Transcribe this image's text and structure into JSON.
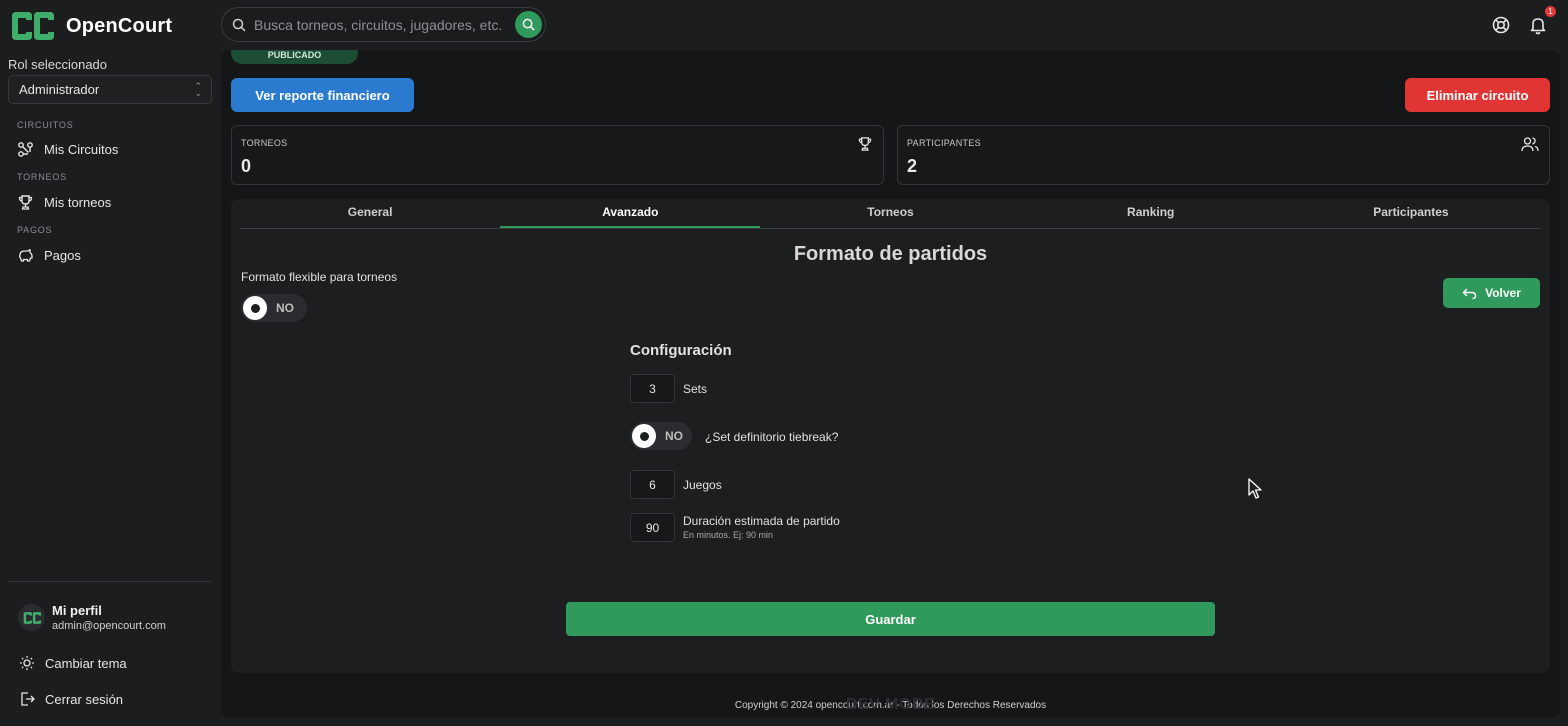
{
  "header": {
    "brand_name": "OpenCourt",
    "search_placeholder": "Busca torneos, circuitos, jugadores, etc.",
    "notification_count": "1"
  },
  "sidebar": {
    "role_label": "Rol seleccionado",
    "role_value": "Administrador",
    "sections": [
      {
        "title": "CIRCUITOS",
        "item": "Mis Circuitos"
      },
      {
        "title": "TORNEOS",
        "item": "Mis torneos"
      },
      {
        "title": "PAGOS",
        "item": "Pagos"
      }
    ],
    "profile": {
      "name": "Mi perfil",
      "email": "admin@opencourt.com"
    },
    "change_theme": "Cambiar tema",
    "logout": "Cerrar sesión"
  },
  "main": {
    "status_badge": "PUBLICADO",
    "financial_report_button": "Ver reporte financiero",
    "delete_circuit_button": "Eliminar circuito",
    "stats": [
      {
        "label": "TORNEOS",
        "value": "0",
        "icon": "trophy-icon"
      },
      {
        "label": "PARTICIPANTES",
        "value": "2",
        "icon": "users-icon"
      }
    ],
    "tabs": [
      {
        "label": "General",
        "active": false
      },
      {
        "label": "Avanzado",
        "active": true
      },
      {
        "label": "Torneos",
        "active": false
      },
      {
        "label": "Ranking",
        "active": false
      },
      {
        "label": "Participantes",
        "active": false
      }
    ],
    "section_title": "Formato de partidos",
    "flexible_label": "Formato flexible para torneos",
    "flexible_toggle": "NO",
    "back_button": "Volver",
    "config": {
      "title": "Configuración",
      "sets_value": "3",
      "sets_label": "Sets",
      "tiebreak_toggle": "NO",
      "tiebreak_label": "¿Set definitorio tiebreak?",
      "games_value": "6",
      "games_label": "Juegos",
      "duration_value": "90",
      "duration_label": "Duración estimada de partido",
      "duration_hint": "En minutos. Ej: 90 min"
    },
    "save_button": "Guardar"
  },
  "footer": {
    "copyright": "Copyright © 2024 opencourt.com.ar - Todos los Derechos Reservados",
    "dev_mode": "DEV MODE"
  },
  "colors": {
    "accent_green": "#2f9a5b",
    "primary_blue": "#2a7bd0",
    "danger_red": "#e13434",
    "background": "#1c1d1f"
  }
}
